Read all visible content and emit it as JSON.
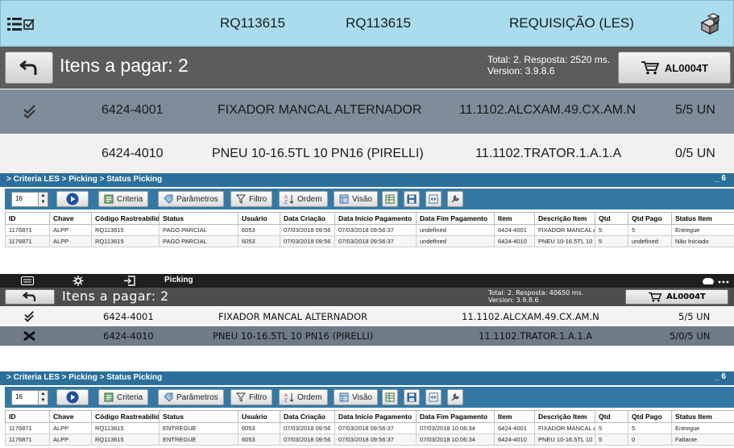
{
  "screen1": {
    "topbar": {
      "field1": "RQ113615",
      "field2": "RQ113615",
      "screen_title": "REQUISIÇÃO (LES)"
    },
    "header": {
      "title": "Itens a pagar: 2",
      "info_line1": "Total: 2. Resposta: 2520 ms.",
      "info_line2": "Version: 3.9.8.6",
      "cart_label": "AL0004T"
    },
    "rows": [
      {
        "code": "6424-4001",
        "description": "FIXADOR MANCAL ALTERNADOR",
        "location": "11.1102.ALCXAM.49.CX.AM.N",
        "qty": "5/5 UN",
        "status_icon": "checkmark-icon"
      },
      {
        "code": "6424-4010",
        "description": "PNEU 10-16.5TL 10 PN16 (PIRELLI)",
        "location": "11.1102.TRATOR.1.A.1.A",
        "qty": "0/5 UN",
        "status_icon": ""
      }
    ]
  },
  "criteria1": {
    "breadcrumb": "> Criteria LES > Picking > Status Picking",
    "minimize": "_ 6",
    "page_size": "16",
    "buttons": {
      "criteria": "Criteria",
      "parametros": "Parâmetros",
      "filtro": "Filtro",
      "ordem": "Ordem",
      "visao": "Visão"
    },
    "columns": [
      "ID",
      "Chave",
      "Código Rastreabilid.",
      "Status",
      "Usuário",
      "Data Criação",
      "Data Início Pagamento",
      "Data Fim Pagamento",
      "Item",
      "Descrição Item",
      "Qtd",
      "Qtd Pago",
      "Status Item"
    ],
    "rows": [
      [
        "1176871",
        "ALPP",
        "RQ113615",
        "PAGO PARCIAL",
        "6053",
        "07/03/2018 09:56",
        "07/03/2018 09:56:37",
        "undefined",
        "6424-4001",
        "FIXADOR MANCAL A",
        "5",
        "5",
        "Entregue"
      ],
      [
        "1176871",
        "ALPP",
        "RQ113615",
        "PAGO PARCIAL",
        "6053",
        "07/03/2018 09:56",
        "07/03/2018 09:56:37",
        "undefined",
        "6424-4010",
        "PNEU 10-16.5TL 10",
        "5",
        "undefined",
        "Não Iniciado"
      ]
    ]
  },
  "screen3": {
    "tab_label": "Picking",
    "header": {
      "title": "Itens a pagar: 2",
      "info_line1": "Total: 2. Resposta: 40650 ms.",
      "info_line2": "Version: 3.9.8.6",
      "cart_label": "AL0004T"
    },
    "rows": [
      {
        "code": "6424-4001",
        "description": "FIXADOR MANCAL ALTERNADOR",
        "location": "11.1102.ALCXAM.49.CX.AM.N",
        "qty": "5/5 UN",
        "status_icon": "checkmark-icon"
      },
      {
        "code": "6424-4010",
        "description": "PNEU 10-16.5TL 10 PN16 (PIRELLI)",
        "location": "11.1102.TRATOR.1.A.1.A",
        "qty": "5/0/5 UN",
        "status_icon": "cross-icon"
      }
    ]
  },
  "criteria2": {
    "breadcrumb": "> Criteria LES > Picking > Status Picking",
    "minimize": "_ 6",
    "page_size": "16",
    "buttons": {
      "criteria": "Criteria",
      "parametros": "Parâmetros",
      "filtro": "Filtro",
      "ordem": "Ordem",
      "visao": "Visão"
    },
    "columns": [
      "ID",
      "Chave",
      "Código Rastreabilid.",
      "Status",
      "Usuário",
      "Data Criação",
      "Data Início Pagamento",
      "Data Fim Pagamento",
      "Item",
      "Descrição Item",
      "Qtd",
      "Qtd Pago",
      "Status Item"
    ],
    "rows": [
      [
        "1176871",
        "ALPP",
        "RQ113615",
        "ENTREGUE",
        "6053",
        "07/03/2018 09:56",
        "07/03/2018 09:56:37",
        "07/03/2018 10:06:34",
        "6424-4001",
        "FIXADOR MANCAL A",
        "5",
        "5",
        "Entregue"
      ],
      [
        "1176871",
        "ALPP",
        "RQ113615",
        "ENTREGUE",
        "6053",
        "07/03/2018 09:56",
        "07/03/2018 09:56:37",
        "07/03/2018 10:06:34",
        "6424-4010",
        "PNEU 10-16.5TL 10",
        "5",
        "0",
        "Faltante"
      ]
    ]
  }
}
